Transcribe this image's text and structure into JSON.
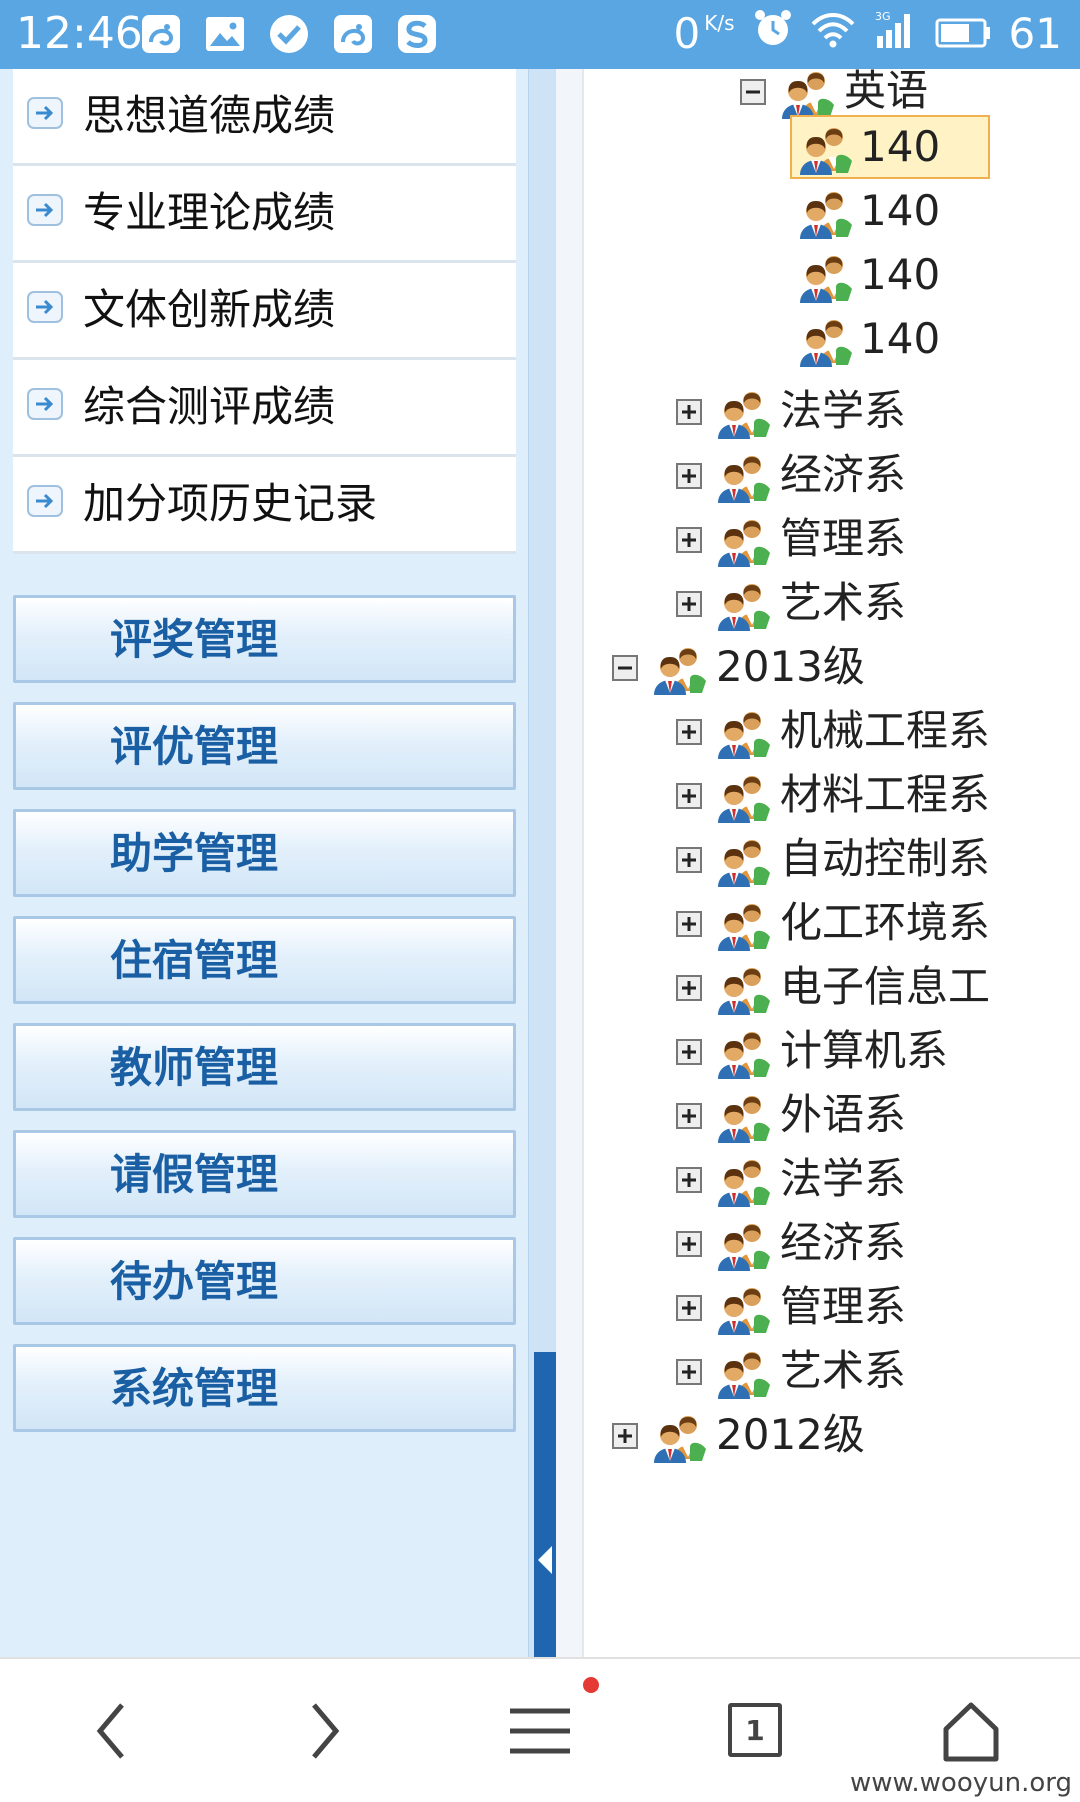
{
  "status_bar": {
    "time": "12:46",
    "net_speed": "0",
    "net_unit": "K/s",
    "battery": "61",
    "notification_icons": [
      "uc-browser-icon",
      "image-icon",
      "check-icon",
      "uc-browser-icon",
      "sogou-icon"
    ]
  },
  "sidebar": {
    "sub_items": [
      {
        "label": "思想道德成绩"
      },
      {
        "label": "专业理论成绩"
      },
      {
        "label": "文体创新成绩"
      },
      {
        "label": "综合测评成绩"
      },
      {
        "label": "加分项历史记录"
      }
    ],
    "menus": [
      {
        "label": "评奖管理"
      },
      {
        "label": "评优管理"
      },
      {
        "label": "助学管理"
      },
      {
        "label": "住宿管理"
      },
      {
        "label": "教师管理"
      },
      {
        "label": "请假管理"
      },
      {
        "label": "待办管理"
      },
      {
        "label": "系统管理"
      }
    ]
  },
  "tree": {
    "nodes": [
      {
        "label": "英语",
        "toggle": "minus",
        "selected": false
      },
      {
        "label": "140",
        "toggle": "none",
        "selected": true
      },
      {
        "label": "140",
        "toggle": "none",
        "selected": false
      },
      {
        "label": "140",
        "toggle": "none",
        "selected": false
      },
      {
        "label": "140",
        "toggle": "none",
        "selected": false
      },
      {
        "label": "法学系",
        "toggle": "plus",
        "selected": false
      },
      {
        "label": "经济系",
        "toggle": "plus",
        "selected": false
      },
      {
        "label": "管理系",
        "toggle": "plus",
        "selected": false
      },
      {
        "label": "艺术系",
        "toggle": "plus",
        "selected": false
      },
      {
        "label": "2013级",
        "toggle": "minus",
        "selected": false
      },
      {
        "label": "机械工程系",
        "toggle": "plus",
        "selected": false
      },
      {
        "label": "材料工程系",
        "toggle": "plus",
        "selected": false
      },
      {
        "label": "自动控制系",
        "toggle": "plus",
        "selected": false
      },
      {
        "label": "化工环境系",
        "toggle": "plus",
        "selected": false
      },
      {
        "label": "电子信息工",
        "toggle": "plus",
        "selected": false
      },
      {
        "label": "计算机系",
        "toggle": "plus",
        "selected": false
      },
      {
        "label": "外语系",
        "toggle": "plus",
        "selected": false
      },
      {
        "label": "法学系",
        "toggle": "plus",
        "selected": false
      },
      {
        "label": "经济系",
        "toggle": "plus",
        "selected": false
      },
      {
        "label": "管理系",
        "toggle": "plus",
        "selected": false
      },
      {
        "label": "艺术系",
        "toggle": "plus",
        "selected": false
      },
      {
        "label": "2012级",
        "toggle": "plus",
        "selected": false
      }
    ]
  },
  "bottom_nav": {
    "tab_count": "1",
    "items": [
      "back-icon",
      "forward-icon",
      "menu-icon",
      "tabs-icon",
      "home-icon"
    ]
  },
  "watermark": "www.wooyun.org",
  "colors": {
    "status_bar": "#5aa6e2",
    "sidebar_bg": "#dfeefb",
    "menu_text": "#1a5fa3",
    "splitter_thumb": "#1f65b0",
    "selection_bg": "#fff3c6",
    "selection_border": "#f0b050"
  }
}
